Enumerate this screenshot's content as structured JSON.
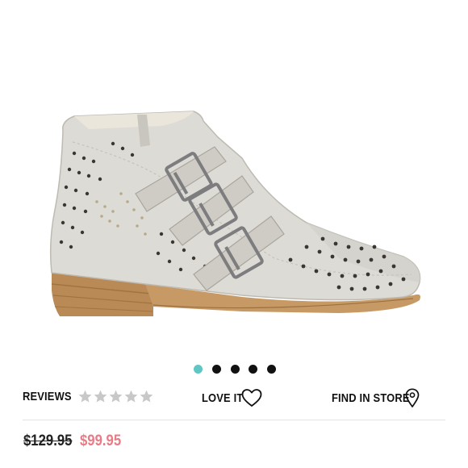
{
  "product": {
    "image_alt": "Perforated buckle ankle boot",
    "carousel": {
      "total": 5,
      "active_index": 0,
      "active_color": "#5ec7c4",
      "inactive_color": "#111111"
    }
  },
  "actions": {
    "reviews_label": "REVIEWS",
    "rating": 0,
    "rating_max": 5,
    "star_color": "#c8c8c8",
    "love_label": "LOVE IT",
    "store_label": "FIND IN STORE",
    "heart_icon": "heart-outline-icon",
    "pin_icon": "map-pin-icon"
  },
  "pricing": {
    "original_price": "$129.95",
    "sale_price": "$99.95",
    "sale_color": "#e97b86"
  }
}
